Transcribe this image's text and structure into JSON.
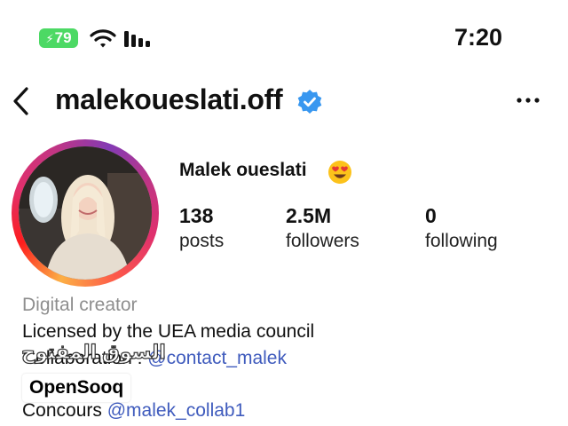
{
  "status_bar": {
    "battery_level": "79",
    "battery_color": "#4cd964",
    "icons": [
      "bolt-icon",
      "wifi-icon",
      "signal-icon"
    ],
    "time": "7:20"
  },
  "header": {
    "username": "malekoueslati.off",
    "verified": true,
    "icons": [
      "back-icon",
      "verified-icon",
      "more-icon"
    ]
  },
  "profile": {
    "display_name": "Malek oueslati",
    "emoji": "heart-eyes-emoji",
    "stats": {
      "posts": {
        "value": "138",
        "label": "posts"
      },
      "followers": {
        "value": "2.5M",
        "label": "followers"
      },
      "following": {
        "value": "0",
        "label": "following"
      }
    }
  },
  "bio": {
    "category": "Digital creator",
    "line1": "Licensed by the UEA media council",
    "collab_prefix": "Collaboration : ",
    "collab_handle": "@contact_malek",
    "concours_prefix": "Concours ",
    "concours_handle": "@malek_collab1"
  },
  "watermark": {
    "arabic": "السوق المفتوح",
    "brand": "OpenSooq"
  },
  "colors": {
    "link": "#3f5bbd",
    "verified": "#3897f0",
    "category": "#8e8e8e"
  }
}
